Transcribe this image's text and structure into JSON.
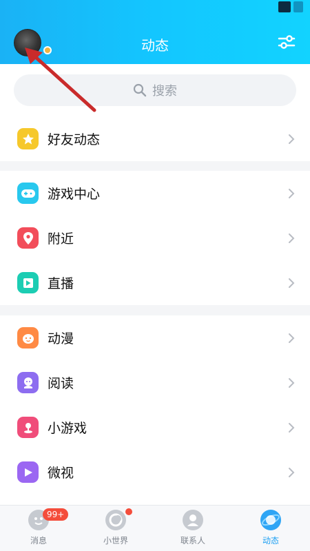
{
  "header": {
    "title": "动态",
    "avatar_icon": "user-avatar",
    "settings_icon": "sliders-icon"
  },
  "search": {
    "placeholder": "搜索"
  },
  "sections": [
    [
      {
        "label": "好友动态",
        "icon": "star-icon",
        "color": "#f6c82b"
      }
    ],
    [
      {
        "label": "游戏中心",
        "icon": "gamepad-icon",
        "color": "#28c8ee"
      },
      {
        "label": "附近",
        "icon": "location-pin-icon",
        "color": "#f24d5a"
      },
      {
        "label": "直播",
        "icon": "live-icon",
        "color": "#1ccdb3"
      }
    ],
    [
      {
        "label": "动漫",
        "icon": "anime-face-icon",
        "color": "#ff8a44"
      },
      {
        "label": "阅读",
        "icon": "reading-icon",
        "color": "#8d6df0"
      },
      {
        "label": "小游戏",
        "icon": "mini-game-icon",
        "color": "#f04d7a"
      },
      {
        "label": "微视",
        "icon": "weishi-play-icon",
        "color": "#9b67f2"
      }
    ]
  ],
  "tabs": [
    {
      "label": "消息",
      "icon": "message-icon",
      "badge": "99+"
    },
    {
      "label": "小世界",
      "icon": "small-world-icon"
    },
    {
      "label": "联系人",
      "icon": "contacts-icon"
    },
    {
      "label": "动态",
      "icon": "dynamics-planet-icon",
      "active": true
    }
  ],
  "colors": {
    "header_gradient_start": "#1ab2f5",
    "header_gradient_end": "#12d3ff",
    "active_tab": "#1c9ff2",
    "badge": "#f44d3b",
    "annotation_arrow": "#c92b2b"
  }
}
